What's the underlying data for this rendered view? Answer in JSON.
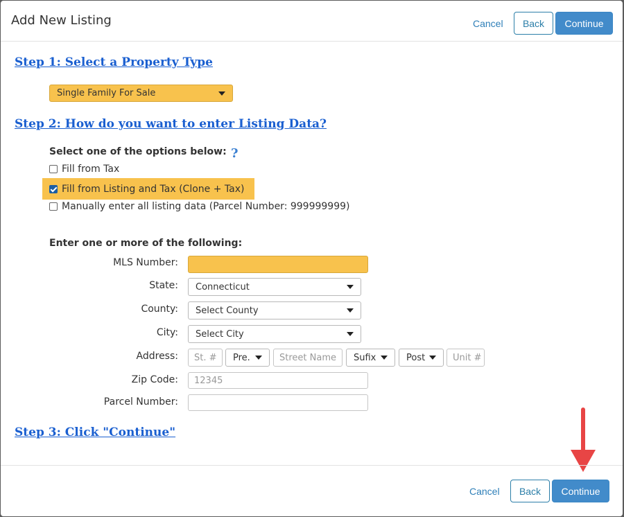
{
  "dialog": {
    "title": "Add New Listing",
    "cancel_label": "Cancel",
    "back_label": "Back",
    "continue_label": "Continue"
  },
  "step1": {
    "heading": "Step 1: Select a Property Type",
    "property_type": "Single Family For Sale"
  },
  "step2": {
    "heading": "Step 2: How do you want to enter Listing Data?",
    "options_label": "Select one of the options below:",
    "help_icon_glyph": "?",
    "options": [
      {
        "label": "Fill from Tax",
        "checked": false
      },
      {
        "label": "Fill from Listing and Tax (Clone + Tax)",
        "checked": true
      },
      {
        "label": "Manually enter all listing data (Parcel Number: 999999999)",
        "checked": false
      }
    ],
    "enter_label": "Enter one or more of the following:",
    "fields": {
      "mls_label": "MLS Number:",
      "mls_value": "",
      "state_label": "State:",
      "state_value": "Connecticut",
      "county_label": "County:",
      "county_value": "Select County",
      "city_label": "City:",
      "city_value": "Select City",
      "address_label": "Address:",
      "street_no_placeholder": "St. #",
      "prefix_value": "Pre.",
      "street_name_placeholder": "Street Name",
      "suffix_value": "Sufix",
      "post_value": "Post",
      "unit_placeholder": "Unit #",
      "zip_label": "Zip Code:",
      "zip_placeholder": "12345",
      "parcel_label": "Parcel Number:",
      "parcel_value": ""
    }
  },
  "step3": {
    "heading": "Step 3: Click \"Continue\""
  },
  "footer": {
    "cancel_label": "Cancel",
    "back_label": "Back",
    "continue_label": "Continue"
  },
  "colors": {
    "highlight": "#f8c24d",
    "primary": "#428bca",
    "link": "#1a5fd0",
    "arrow": "#e84545"
  }
}
